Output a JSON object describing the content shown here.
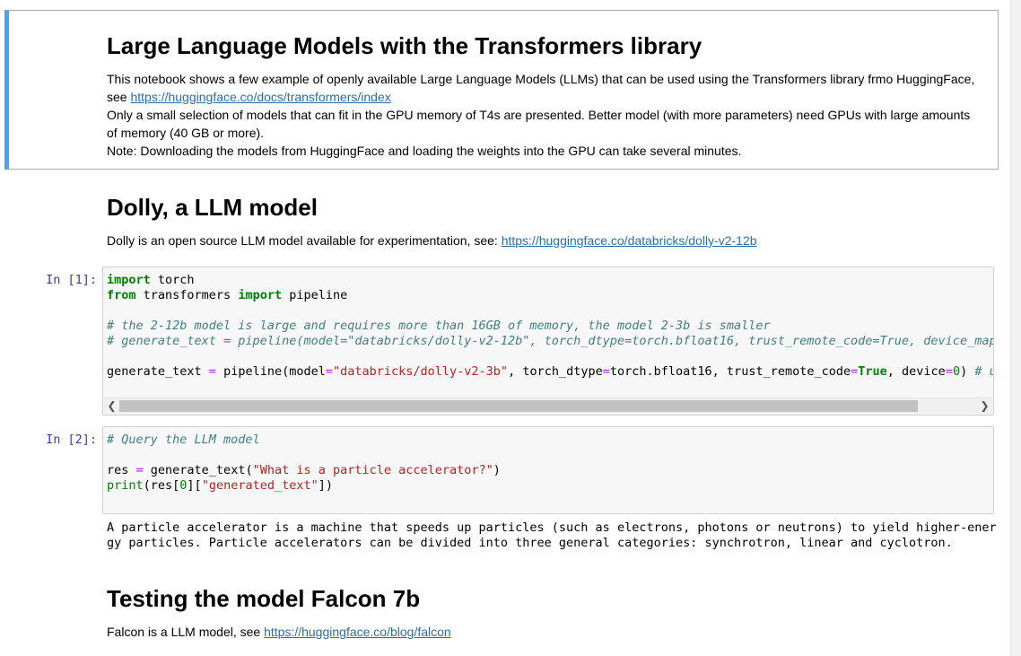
{
  "cells": {
    "intro": {
      "title": "Large Language Models with the Transformers library",
      "p1": "This notebook shows a few example of openly available Large Language Models (LLMs) that can be used using the Transformers library frmo HuggingFace,",
      "p1b_prefix": "see ",
      "p1b_link": "https://huggingface.co/docs/transformers/index",
      "p2": "Only a small selection of models that can fit in the GPU memory of T4s are presented. Better model (with more parameters) need GPUs with large amounts",
      "p2b": "of memory (40 GB or more).",
      "p3": "Note: Downloading the models from HuggingFace and loading the weights into the GPU can take several minutes."
    },
    "dolly": {
      "title": "Dolly, a LLM model",
      "text": "Dolly is an open source LLM model available for experimentation, see: ",
      "link": "https://huggingface.co/databricks/dolly-v2-12b"
    },
    "code1": {
      "prompt": "In [1]:"
    },
    "code2": {
      "prompt": "In [2]:"
    },
    "output2": {
      "line1": "A particle accelerator is a machine that speeds up particles (such as electrons, photons or neutrons) to yield higher-ener",
      "line2": "gy particles. Particle accelerators can be divided into three general categories: synchrotron, linear and cyclotron."
    },
    "falcon": {
      "title": "Testing the model Falcon 7b",
      "text": "Falcon is a LLM model, see ",
      "link": "https://huggingface.co/blog/falcon"
    }
  },
  "colors": {
    "selection_bar": "#42a5f5",
    "prompt": "#303f9f",
    "link": "#296eaa"
  }
}
